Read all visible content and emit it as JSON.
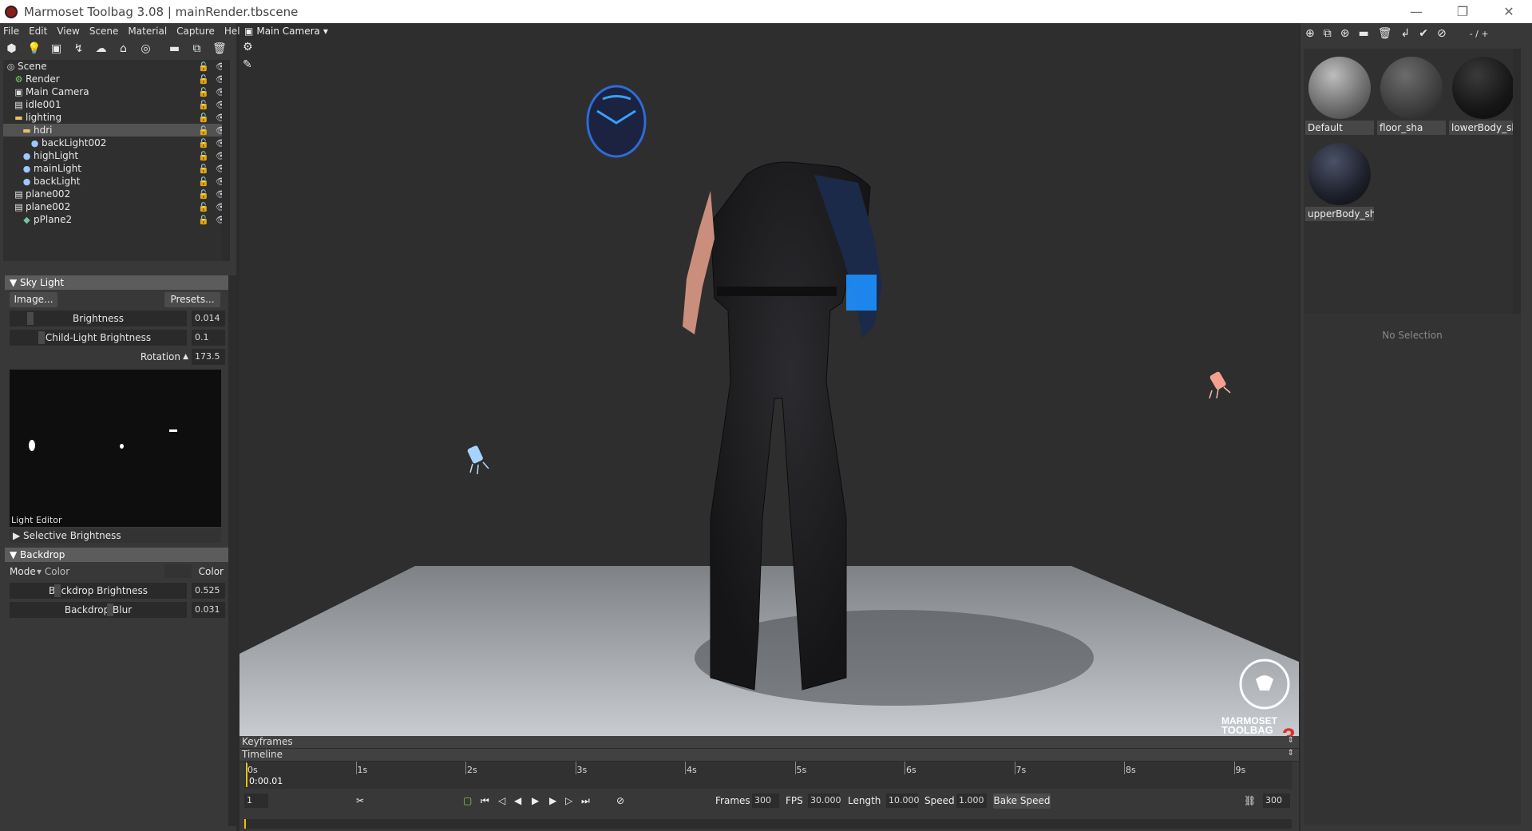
{
  "window": {
    "title": "Marmoset Toolbag 3.08  |  mainRender.tbscene",
    "controls": [
      "—",
      "❐",
      "✕"
    ]
  },
  "menu": [
    "File",
    "Edit",
    "View",
    "Scene",
    "Material",
    "Capture",
    "Help"
  ],
  "scene_tree": [
    {
      "label": "Scene",
      "indent": 0,
      "icon": "globe-icon",
      "selected": false
    },
    {
      "label": "Render",
      "indent": 1,
      "icon": "gear-icon",
      "selected": false
    },
    {
      "label": "Main Camera",
      "indent": 1,
      "icon": "camera-icon",
      "selected": false
    },
    {
      "label": "idle001",
      "indent": 1,
      "icon": "mesh-icon",
      "selected": false
    },
    {
      "label": "lighting",
      "indent": 1,
      "icon": "folder-icon",
      "selected": false
    },
    {
      "label": "hdri",
      "indent": 2,
      "icon": "folder-icon",
      "selected": true
    },
    {
      "label": "backLight002",
      "indent": 3,
      "icon": "light-icon",
      "selected": false
    },
    {
      "label": "highLight",
      "indent": 2,
      "icon": "light-icon",
      "selected": false
    },
    {
      "label": "mainLight",
      "indent": 2,
      "icon": "light-icon",
      "selected": false
    },
    {
      "label": "backLight",
      "indent": 2,
      "icon": "light-icon",
      "selected": false
    },
    {
      "label": "plane002",
      "indent": 1,
      "icon": "mesh-icon",
      "selected": false
    },
    {
      "label": "plane002",
      "indent": 1,
      "icon": "mesh-icon",
      "selected": false
    },
    {
      "label": "pPlane2",
      "indent": 2,
      "icon": "object-icon",
      "selected": false
    }
  ],
  "sky_light": {
    "header": "Sky Light",
    "image_btn": "Image...",
    "presets_btn": "Presets...",
    "brightness_label": "Brightness",
    "brightness_value": "0.014",
    "child_label": "Child-Light Brightness",
    "child_value": "0.1",
    "rotation_label": "Rotation",
    "rotation_value": "173.5",
    "light_editor": "Light Editor",
    "selective": "Selective Brightness"
  },
  "backdrop": {
    "header": "Backdrop",
    "mode_label": "Mode",
    "mode_value": "Color",
    "color_label": "Color",
    "brightness_label": "Backdrop Brightness",
    "brightness_value": "0.525",
    "blur_label": "Backdrop Blur",
    "blur_value": "0.031"
  },
  "viewport": {
    "camera": "Main Camera",
    "logo_line1": "MARMOSET",
    "logo_line2": "TOOLBAG"
  },
  "materials": [
    {
      "name": "Default",
      "color": "#8a8a8a"
    },
    {
      "name": "floor_sha",
      "color": "#4a4a4a"
    },
    {
      "name": "lowerBody_sha",
      "color": "#1c1c1c"
    },
    {
      "name": "upperBody_sha",
      "color": "#2a2a30"
    }
  ],
  "right_tools_label": "- / +",
  "no_selection": "No Selection",
  "timeline": {
    "keyframes": "Keyframes",
    "timeline": "Timeline",
    "ticks": [
      "0s",
      "1s",
      "2s",
      "3s",
      "4s",
      "5s",
      "6s",
      "7s",
      "8s",
      "9s"
    ],
    "current_time": "0:00.01",
    "frame": "1",
    "frames_label": "Frames",
    "frames_value": "300",
    "fps_label": "FPS",
    "fps_value": "30.000",
    "length_label": "Length",
    "length_value": "10.000",
    "speed_label": "Speed",
    "speed_value": "1.000",
    "bake_speed": "Bake Speed",
    "end_value": "300"
  }
}
